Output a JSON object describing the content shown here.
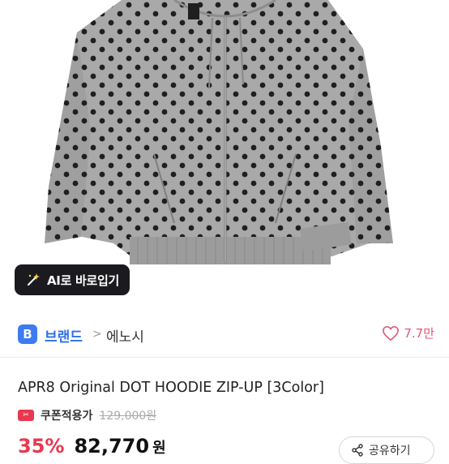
{
  "hero": {
    "ai_button_label": "AI로 바로입기"
  },
  "brand": {
    "badge": "B",
    "label": "브랜드",
    "chevron": ">",
    "name": "에노시",
    "likes": "7.7만"
  },
  "product": {
    "title": "APR8 Original DOT HOODIE ZIP-UP [3Color]",
    "coupon_label": "쿠폰적용가",
    "original_price": "129,000원",
    "discount": "35%",
    "sale_price": "82,770",
    "currency": "원"
  },
  "actions": {
    "share_label": "공유하기"
  },
  "colors": {
    "accent_blue": "#3c7bf0",
    "sale_red": "#e8384f",
    "heart_pink": "#e0577a",
    "hoodie_gray": "#a9a9a9",
    "dot": "#222222"
  }
}
